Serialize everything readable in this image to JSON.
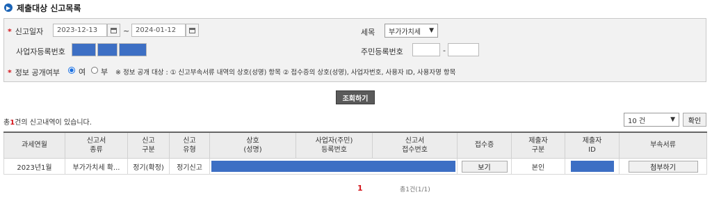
{
  "page": {
    "title": "제출대상 신고목록"
  },
  "search": {
    "report_date_label": "신고일자",
    "date_from": "2023-12-13",
    "date_sep": "~",
    "date_to": "2024-01-12",
    "tax_item_label": "세목",
    "tax_item_value": "부가가치세",
    "biz_reg_label": "사업자등록번호",
    "resident_reg_label": "주민등록번호",
    "resident_reg_sep": "-",
    "disclose_label": "정보 공개여부",
    "disclose_yes": "여",
    "disclose_no": "부",
    "disclose_note": "※ 정보 공개 대상 : ① 신고부속서류 내역의 상호(성명) 항목 ② 접수증의 상호(성명), 사업자번호, 사용자 ID, 사용자명 항목",
    "submit_label": "조회하기"
  },
  "results": {
    "summary_prefix": "총",
    "summary_count": "1",
    "summary_suffix": "건의 신고내역이 있습니다.",
    "page_size_value": "10 건",
    "confirm_label": "확인",
    "columns": [
      [
        "과세연월",
        ""
      ],
      [
        "신고서",
        "종류"
      ],
      [
        "신고",
        "구분"
      ],
      [
        "신고",
        "유형"
      ],
      [
        "상호",
        "(성명)"
      ],
      [
        "사업자(주민)",
        "등록번호"
      ],
      [
        "신고서",
        "접수번호"
      ],
      [
        "접수증",
        ""
      ],
      [
        "제출자",
        "구분"
      ],
      [
        "제출자",
        "ID"
      ],
      [
        "부속서류",
        ""
      ]
    ],
    "rows": [
      {
        "period": "2023년1월",
        "form_type": "부가가치세 확...",
        "report_class": "정기(확정)",
        "report_type": "정기신고",
        "receipt_button": "보기",
        "submitter_type": "본인",
        "attach_button": "첨부하기"
      }
    ]
  },
  "pagination": {
    "current": "1",
    "summary": "총1건(1/1)"
  },
  "colors": {
    "accent": "#1a63b6",
    "required": "#d4141a",
    "redaction": "#3d6fc4",
    "page_current": "#d4141a"
  }
}
